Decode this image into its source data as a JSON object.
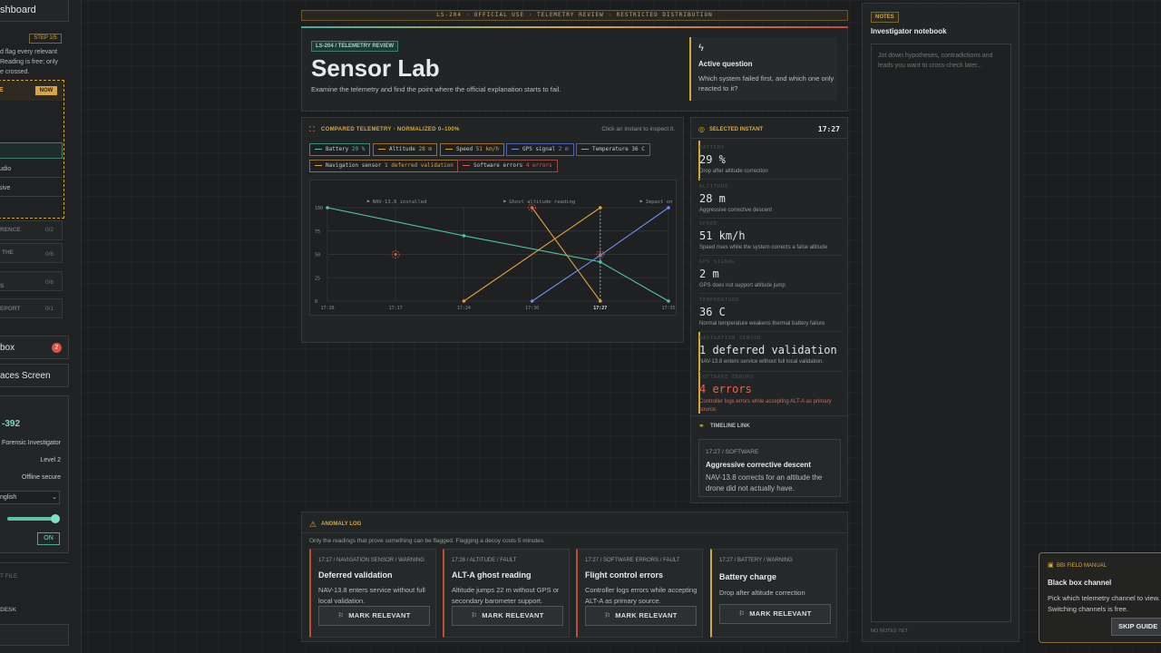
{
  "sidebar": {
    "dashboard_label": "shboard",
    "step_badge": "STEP 1/5",
    "intro_lines": [
      "d flag every relevant",
      "Reading is free; only",
      "e crossed."
    ],
    "active_task": {
      "label": "E",
      "badge": "NOW"
    },
    "sub_items": [
      "udio",
      "sive"
    ],
    "tasks": [
      {
        "label": "RENCE",
        "count": "0/2"
      },
      {
        "label": "THE",
        "count": "0/6"
      },
      {
        "label": "S",
        "count": "0/6"
      },
      {
        "label": "EPORT",
        "count": "0/1"
      }
    ],
    "inbox_label": "box",
    "inbox_badge": "2",
    "evidence_label": "aces Screen",
    "profile": {
      "id": "-392",
      "role": "Forensic Investigator",
      "level": "Level 2",
      "status": "Offline secure",
      "language": "nglish",
      "toggle": "ON"
    },
    "file_label": "T FILE",
    "desk_label": "DESK"
  },
  "banner": "LS-204 · OFFICIAL USE · TELEMETRY REVIEW · RESTRICTED DISTRIBUTION",
  "header": {
    "tag": "LS-204 / TELEMETRY REVIEW",
    "title": "Sensor Lab",
    "subtitle": "Examine the telemetry and find the point where the official explanation starts to fail."
  },
  "question": {
    "label": "Active question",
    "text": "Which system failed first, and which one only reacted to it?"
  },
  "telemetry": {
    "title": "COMPARED TELEMETRY · NORMALIZED 0–100%",
    "hint": "Click an instant to inspect it.",
    "legend": [
      {
        "name": "Battery",
        "value": "29 %",
        "color": "#4fc3a5"
      },
      {
        "name": "Altitude",
        "value": "28 m",
        "color": "#e0a040"
      },
      {
        "name": "Speed",
        "value": "51 km/h",
        "color": "#e0a040"
      },
      {
        "name": "GPS signal",
        "value": "2 m",
        "color": "#6d8ff0"
      },
      {
        "name": "Temperature",
        "value": "36 C",
        "color": "#9aa0a2"
      },
      {
        "name": "Navigation sensor",
        "value": "1 deferred validation",
        "color": "#e0a040"
      },
      {
        "name": "Software errors",
        "value": "4 errors",
        "color": "#e05a4a"
      }
    ]
  },
  "chart_data": {
    "type": "line",
    "title": "COMPARED TELEMETRY · NORMALIZED 0–100%",
    "x": [
      "17:10",
      "17:17",
      "17:24",
      "17:30",
      "17:27",
      "17:35"
    ],
    "ylim": [
      0,
      100
    ],
    "yticks": [
      "100",
      "75",
      "50",
      "25",
      "0"
    ],
    "events": [
      {
        "label": "NAV-13.8 installed",
        "x": "17:17"
      },
      {
        "label": "Ghost altitude reading",
        "x": "17:30"
      },
      {
        "label": "Impact on ",
        "x": "17:35"
      }
    ],
    "selected_x": "17:27",
    "series": [
      {
        "name": "Battery",
        "color": "#4fc3a5",
        "values": [
          100,
          null,
          70,
          null,
          42,
          0
        ]
      },
      {
        "name": "Altitude",
        "color": "#e0a040",
        "values": [
          null,
          null,
          null,
          100,
          0,
          null
        ]
      },
      {
        "name": "Speed",
        "color": "#e0a040",
        "values": [
          null,
          null,
          0,
          null,
          100,
          null
        ]
      },
      {
        "name": "GPS signal",
        "color": "#6d8ff0",
        "values": [
          null,
          null,
          null,
          0,
          49,
          100
        ]
      }
    ]
  },
  "instant": {
    "title": "SELECTED INSTANT",
    "time": "17:27",
    "rows": [
      {
        "label": "BATTERY",
        "value": "29 %",
        "desc": "Drop after altitude correction",
        "color": "#e0e3e4"
      },
      {
        "label": "ALTITUDE",
        "value": "28 m",
        "desc": "Aggressive corrective descent",
        "color": "#e0e3e4"
      },
      {
        "label": "SPEED",
        "value": "51 km/h",
        "desc": "Speed rises while the system corrects a false altitude",
        "color": "#e0e3e4"
      },
      {
        "label": "GPS SIGNAL",
        "value": "2 m",
        "desc": "GPS does not support altitude jump",
        "color": "#e0e3e4"
      },
      {
        "label": "TEMPERATURE",
        "value": "36 C",
        "desc": "Normal temperature weakens thermal battery failure",
        "color": "#e0e3e4"
      },
      {
        "label": "NAVIGATION SENSOR",
        "value": "1 deferred validation",
        "desc": "NAV-13.8 enters service without full local validation.",
        "color": "#e0e3e4"
      },
      {
        "label": "SOFTWARE ERRORS",
        "value": "4 errors",
        "desc": "Controller logs errors while accepting ALT-A as primary source.",
        "color": "#e0684f"
      }
    ],
    "link_title": "TIMELINE LINK",
    "link": {
      "meta": "17:27 / SOFTWARE",
      "title": "Aggressive corrective descent",
      "desc": "NAV-13.8 corrects for an altitude the drone did not actually have."
    }
  },
  "anomaly": {
    "title": "ANOMALY LOG",
    "subtitle": "Only the readings that prove something can be flagged. Flagging a decoy costs 5 minutes.",
    "button_label": "MARK RELEVANT",
    "cards": [
      {
        "meta": "17:17 / NAVIGATION SENSOR / WARNING",
        "title": "Deferred validation",
        "desc": "NAV-13.8 enters service without full local validation.",
        "accent": "#c44a3a"
      },
      {
        "meta": "17:26 / ALTITUDE / FAULT",
        "title": "ALT-A ghost reading",
        "desc": "Altitude jumps 22 m without GPS or secondary barometer support.",
        "accent": "#c44a3a"
      },
      {
        "meta": "17:27 / SOFTWARE ERRORS / FAULT",
        "title": "Flight control errors",
        "desc": "Controller logs errors while accepting ALT-A as primary source.",
        "accent": "#c44a3a"
      },
      {
        "meta": "17:27 / BATTERY / WARNING",
        "title": "Battery charge",
        "desc": "Drop after altitude correction",
        "accent": "#d8a640"
      }
    ]
  },
  "notes": {
    "tag": "NOTES",
    "title": "Investigator notebook",
    "placeholder": "Jot down hypotheses, contradictions and leads you want to cross-check later...",
    "footer": "NO NOTES YET"
  },
  "manual": {
    "tag": "BBI FIELD MANUAL",
    "title": "Black box channel",
    "desc": "Pick which telemetry channel to view. Switching channels is free.",
    "button": "SKIP GUIDE"
  }
}
